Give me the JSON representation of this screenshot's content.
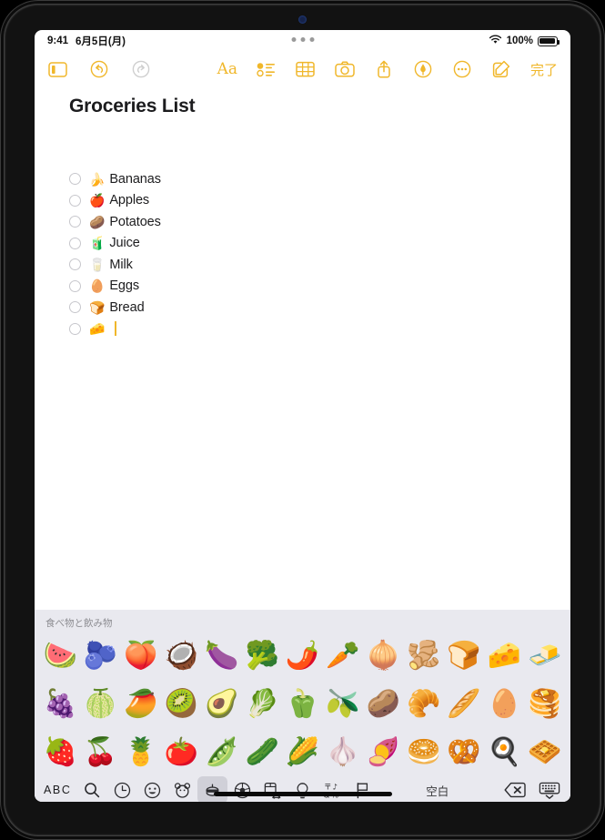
{
  "status_bar": {
    "time": "9:41",
    "date": "6月5日(月)",
    "wifi_icon": "wifi-icon",
    "battery_percent": "100%",
    "battery_icon": "battery-full-icon",
    "multitask_dots": "multitasking-controls"
  },
  "toolbar": {
    "sidebar_icon": "sidebar-toggle-icon",
    "undo_icon": "undo-icon",
    "redo_icon": "redo-icon",
    "format_label": "Aa",
    "checklist_icon": "checklist-icon",
    "table_icon": "table-icon",
    "camera_icon": "camera-icon",
    "share_icon": "share-icon",
    "markup_icon": "markup-pen-icon",
    "more_icon": "more-ellipsis-icon",
    "compose_icon": "compose-icon",
    "done_label": "完了"
  },
  "note": {
    "title": "Groceries List",
    "items": [
      {
        "emoji": "🍌",
        "label": "Bananas",
        "checked": false
      },
      {
        "emoji": "🍎",
        "label": "Apples",
        "checked": false
      },
      {
        "emoji": "🥔",
        "label": "Potatoes",
        "checked": false
      },
      {
        "emoji": "🧃",
        "label": "Juice",
        "checked": false
      },
      {
        "emoji": "🥛",
        "label": "Milk",
        "checked": false
      },
      {
        "emoji": "🥚",
        "label": "Eggs",
        "checked": false
      },
      {
        "emoji": "🍞",
        "label": "Bread",
        "checked": false
      },
      {
        "emoji": "🧀",
        "label": "",
        "checked": false,
        "cursor": true
      }
    ]
  },
  "keyboard": {
    "category_title": "食べ物と飲み物",
    "rows": [
      [
        "🍉",
        "🫐",
        "🍑",
        "🥥",
        "🍆",
        "🥦",
        "🌶️",
        "🥕",
        "🧅",
        "🫚",
        "🍞",
        "🧀",
        "🧈"
      ],
      [
        "🍇",
        "🍈",
        "🥭",
        "🥝",
        "🥑",
        "🥬",
        "🫑",
        "🫒",
        "🥔",
        "🥐",
        "🥖",
        "🥚",
        "🥞"
      ],
      [
        "🍓",
        "🍒",
        "🍍",
        "🍅",
        "🫛",
        "🥒",
        "🌽",
        "🧄",
        "🍠",
        "🥯",
        "🥨",
        "🍳",
        "🧇"
      ]
    ],
    "bottom_bar": {
      "abc_label": "ABC",
      "search_icon": "search-icon",
      "recent_icon": "clock-recents-icon",
      "smileys_icon": "smileys-emoji-icon",
      "animals_icon": "animals-nature-icon",
      "food_icon": "food-drink-icon",
      "activity_icon": "activity-sports-icon",
      "travel_icon": "travel-places-icon",
      "objects_icon": "objects-lightbulb-icon",
      "symbols_icon": "symbols-icon",
      "flags_icon": "flags-icon",
      "space_label": "空白",
      "delete_icon": "delete-backspace-icon",
      "dismiss_icon": "dismiss-keyboard-icon",
      "selected_category": "food-drink-icon"
    }
  },
  "colors": {
    "accent": "#f0b72b",
    "keyboard_bg": "#e9e9ef",
    "text": "#1c1c1e"
  }
}
